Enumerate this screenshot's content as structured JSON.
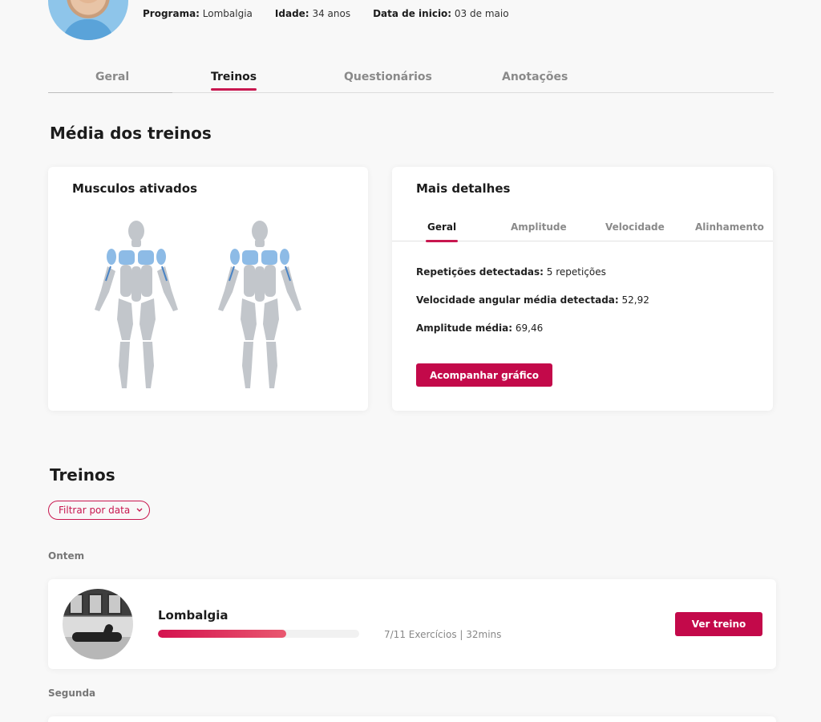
{
  "patient": {
    "program_label": "Programa:",
    "program_value": "Lombalgia",
    "age_label": "Idade:",
    "age_value": "34 anos",
    "start_label": "Data de inicio:",
    "start_value": "03 de maio"
  },
  "tabs": [
    "Geral",
    "Treinos",
    "Questionários",
    "Anotações"
  ],
  "active_tab": "Treinos",
  "average_section": {
    "title": "Média dos treinos",
    "muscles_card_title": "Musculos ativados",
    "details_card": {
      "title": "Mais detalhes",
      "subtabs": [
        "Geral",
        "Amplitude",
        "Velocidade",
        "Alinhamento"
      ],
      "active_subtab": "Geral",
      "reps_label": "Repetições detectadas:",
      "reps_value": "5 repetições",
      "velocity_label": "Velocidade angular média detectada:",
      "velocity_value": "52,92",
      "amplitude_label": "Amplitude média:",
      "amplitude_value": "69,46",
      "chart_button": "Acompanhar gráfico"
    }
  },
  "workouts_section": {
    "title": "Treinos",
    "filter_label": "Filtrar por data",
    "groups": [
      {
        "day": "Ontem",
        "items": [
          {
            "name": "Lombalgia",
            "progress_fraction": 0.6364,
            "meta": "7/11 Exercícios | 32mins",
            "button": "Ver treino"
          }
        ]
      },
      {
        "day": "Segunda"
      }
    ]
  },
  "colors": {
    "accent": "#c3094a",
    "muscle_highlight": "#8dbbe6",
    "muscle_base": "#c2c6cb"
  },
  "icons": {
    "filter_chevron": "chevron-down-icon"
  }
}
